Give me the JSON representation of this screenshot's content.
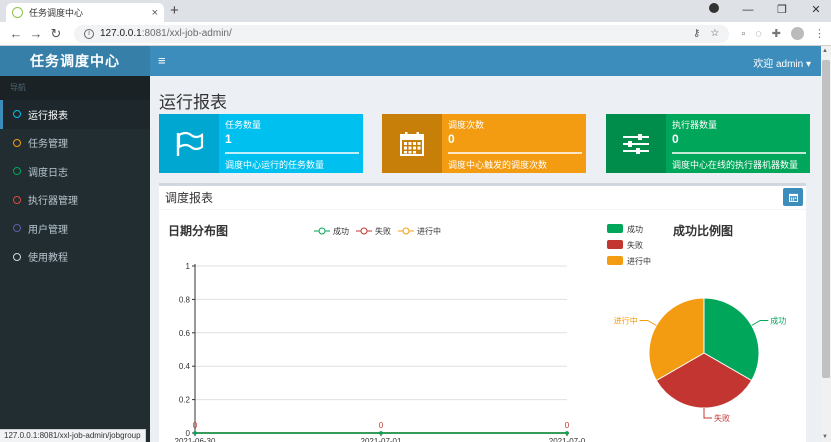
{
  "browser": {
    "tab_title": "任务调度中心",
    "tab_close": "×",
    "new_tab": "+",
    "url_host": "127.0.0.1",
    "url_path": ":8081/xxl-job-admin/",
    "status_url": "127.0.0.1:8081/xxl-job-admin/jobgroup"
  },
  "app": {
    "logo": "任务调度中心",
    "user_menu": "欢迎 admin ▾"
  },
  "sidebar": {
    "header": "导航",
    "items": [
      {
        "label": "运行报表",
        "color": "#00c0ef",
        "active": true
      },
      {
        "label": "任务管理",
        "color": "#f39c12",
        "active": false
      },
      {
        "label": "调度日志",
        "color": "#00a65a",
        "active": false
      },
      {
        "label": "执行器管理",
        "color": "#dd4b39",
        "active": false
      },
      {
        "label": "用户管理",
        "color": "#605ca8",
        "active": false
      },
      {
        "label": "使用教程",
        "color": "#d2d6de",
        "active": false
      }
    ]
  },
  "page_title": "运行报表",
  "info_boxes": [
    {
      "label": "任务数量",
      "value": "1",
      "desc": "调度中心运行的任务数量",
      "icon": "flag-icon",
      "color": "#00c0ef",
      "icon_bg": "#00a7d0"
    },
    {
      "label": "调度次数",
      "value": "0",
      "desc": "调度中心触发的调度次数",
      "icon": "calendar-icon",
      "color": "#f39c12",
      "icon_bg": "#c87f0a"
    },
    {
      "label": "执行器数量",
      "value": "0",
      "desc": "调度中心在线的执行器机器数量",
      "icon": "sliders-icon",
      "color": "#00a65a",
      "icon_bg": "#008d4c"
    }
  ],
  "panel": {
    "title": "调度报表"
  },
  "colors": {
    "success": "#00a65a",
    "fail": "#c23531",
    "running": "#f39c12"
  },
  "chart_data": [
    {
      "type": "line",
      "title": "日期分布图",
      "categories": [
        "2021-06-30",
        "2021-07-01",
        "2021-07-0"
      ],
      "series": [
        {
          "name": "成功",
          "values": [
            0,
            0,
            0
          ]
        },
        {
          "name": "失败",
          "values": [
            0,
            0,
            0
          ]
        },
        {
          "name": "进行中",
          "values": [
            0,
            0,
            0
          ]
        }
      ],
      "y_ticks": [
        "0",
        "0.2",
        "0.4",
        "0.6",
        "0.8",
        "1"
      ],
      "data_labels": [
        "0",
        "0",
        "0"
      ],
      "ylim": [
        0,
        1
      ],
      "legend_position": "top",
      "grid": true
    },
    {
      "type": "pie",
      "title": "成功比例图",
      "slices": [
        {
          "name": "成功",
          "value": 0.3333
        },
        {
          "name": "失败",
          "value": 0.3333
        },
        {
          "name": "进行中",
          "value": 0.3333
        }
      ],
      "legend_position": "top-left"
    }
  ]
}
